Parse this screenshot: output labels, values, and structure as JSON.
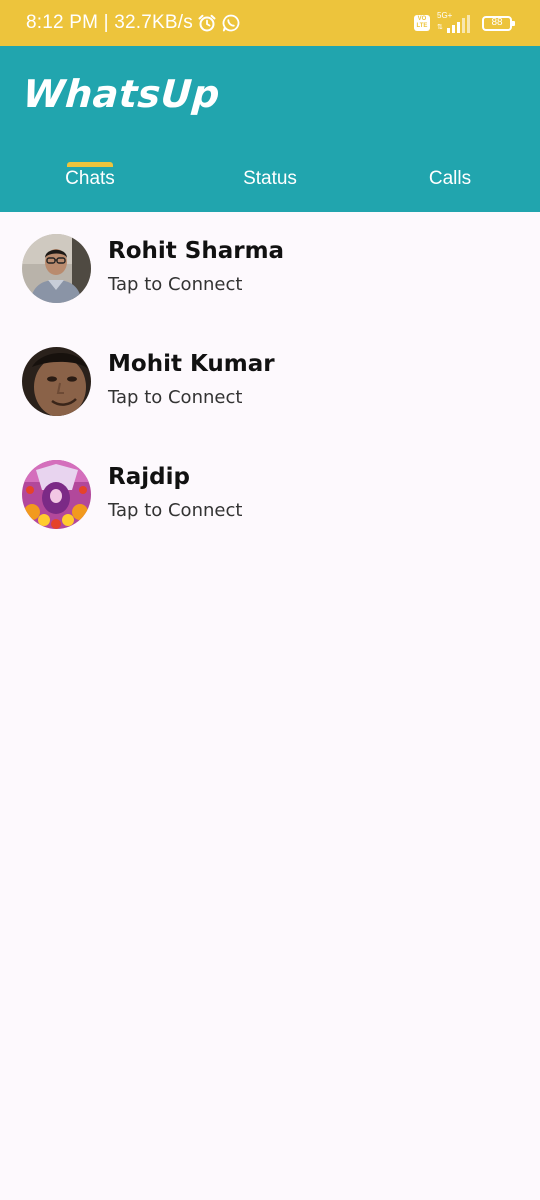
{
  "status_bar": {
    "time": "8:12 PM",
    "speed": "32.7KB/s",
    "network": "5G+",
    "volte": "VO LTE",
    "battery": "88",
    "icons": [
      "alarm-icon",
      "whatsapp-icon",
      "signal-icon"
    ],
    "color": "#edc43c"
  },
  "app_bar": {
    "title": "WhatsUp",
    "color": "#21a5ae"
  },
  "tabs": [
    {
      "label": "Chats",
      "active": true
    },
    {
      "label": "Status",
      "active": false
    },
    {
      "label": "Calls",
      "active": false
    }
  ],
  "accent": "#edc43c",
  "chats": [
    {
      "name": "Rohit Sharma",
      "subtitle": "Tap to Connect"
    },
    {
      "name": "Mohit Kumar",
      "subtitle": "Tap to Connect"
    },
    {
      "name": "Rajdip",
      "subtitle": "Tap to Connect"
    }
  ]
}
